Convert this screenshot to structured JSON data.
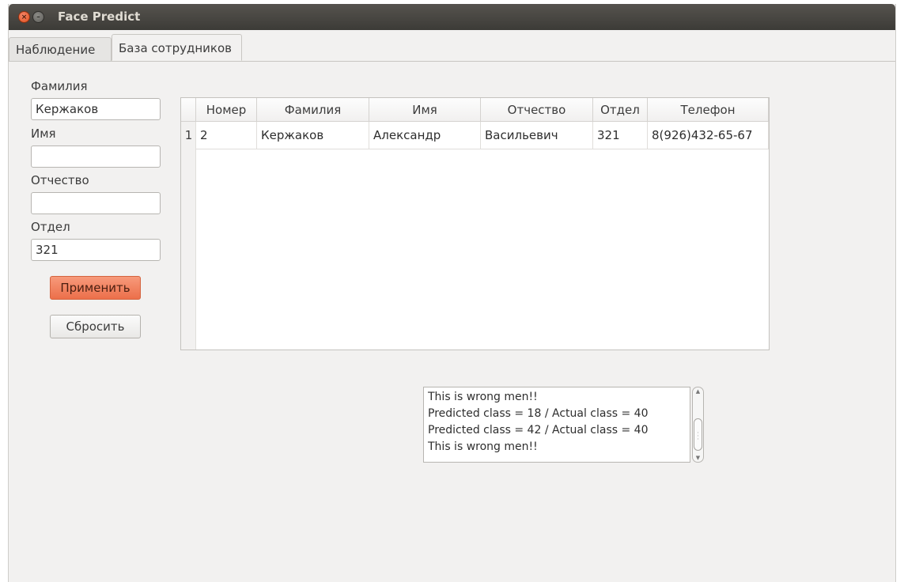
{
  "window": {
    "title": "Face Predict"
  },
  "tabs": [
    {
      "label": "Наблюдение",
      "active": false
    },
    {
      "label": "База сотрудников",
      "active": true
    }
  ],
  "form": {
    "surname_label": "Фамилия",
    "surname_value": "Кержаков",
    "name_label": "Имя",
    "name_value": "",
    "patronymic_label": "Отчество",
    "patronymic_value": "",
    "department_label": "Отдел",
    "department_value": "321",
    "apply_label": "Применить",
    "reset_label": "Сбросить"
  },
  "table": {
    "columns": [
      "Номер",
      "Фамилия",
      "Имя",
      "Отчество",
      "Отдел",
      "Телефон"
    ],
    "rows": [
      {
        "index": "1",
        "cells": [
          "2",
          "Кержаков",
          "Александр",
          "Васильевич",
          "321",
          "8(926)432-65-67"
        ]
      }
    ]
  },
  "log": {
    "lines": [
      "This is wrong men!!",
      "Predicted class = 18 / Actual class = 40",
      "Predicted class = 42 / Actual class = 40",
      "This is wrong men!!"
    ]
  },
  "colors": {
    "titlebar": "#3c3b37",
    "accent_button": "#ec6f4a",
    "window_bg": "#f2f1f0"
  },
  "icons": {
    "close": "close-icon",
    "minimize": "minimize-icon"
  }
}
